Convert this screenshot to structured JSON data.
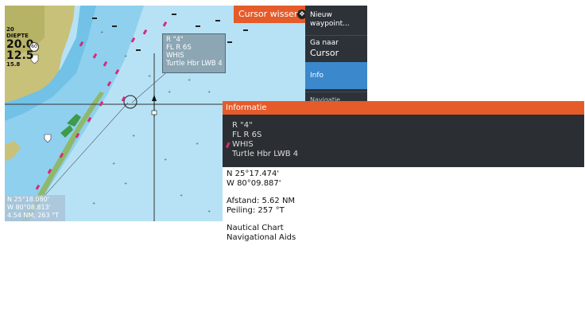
{
  "chart": {
    "speed_top": "20",
    "speed_top_label": "DIEPTE",
    "speed_big": "20.0",
    "speed_mid": "12.5",
    "speed_sub": "15.8",
    "sign_value": "60",
    "tooltip": {
      "line1": "R \"4\"",
      "line2": "FL R 6S",
      "line3": "WHIS",
      "line4": "Turtle Hbr LWB 4"
    },
    "position": {
      "lat": "N  25°18.080'",
      "lon": "W  80°08.813'",
      "dist": "4.54 NM, 263 °T"
    }
  },
  "cursor_clear": {
    "label": "Cursor wissen",
    "icon": "cursor-target-icon"
  },
  "side_menu": {
    "item1_line1": "Nieuw",
    "item1_line2": "waypoint...",
    "item2_line1": "Ga naar",
    "item2_line2": "Cursor",
    "item3": "Info",
    "item4": "Navigatie"
  },
  "info_panel": {
    "title": "Informatie",
    "detail": {
      "line1": "R \"4\"",
      "line2": "FL R 6S",
      "line3": "WHIS",
      "line4": "Turtle Hbr LWB 4"
    },
    "lat": "N  25°17.474'",
    "lon": "W  80°09.887'",
    "distance": "Afstand: 5.62 NM",
    "bearing": "Peiling: 257 °T",
    "source1": "Nautical Chart",
    "source2": "Navigational Aids"
  },
  "colors": {
    "accent": "#e55b2a",
    "menu_bg": "#2d3238",
    "selected": "#3b88cc",
    "water": "#a9dcf2",
    "land": "#c8c17a",
    "shallow": "#72c1e6"
  }
}
